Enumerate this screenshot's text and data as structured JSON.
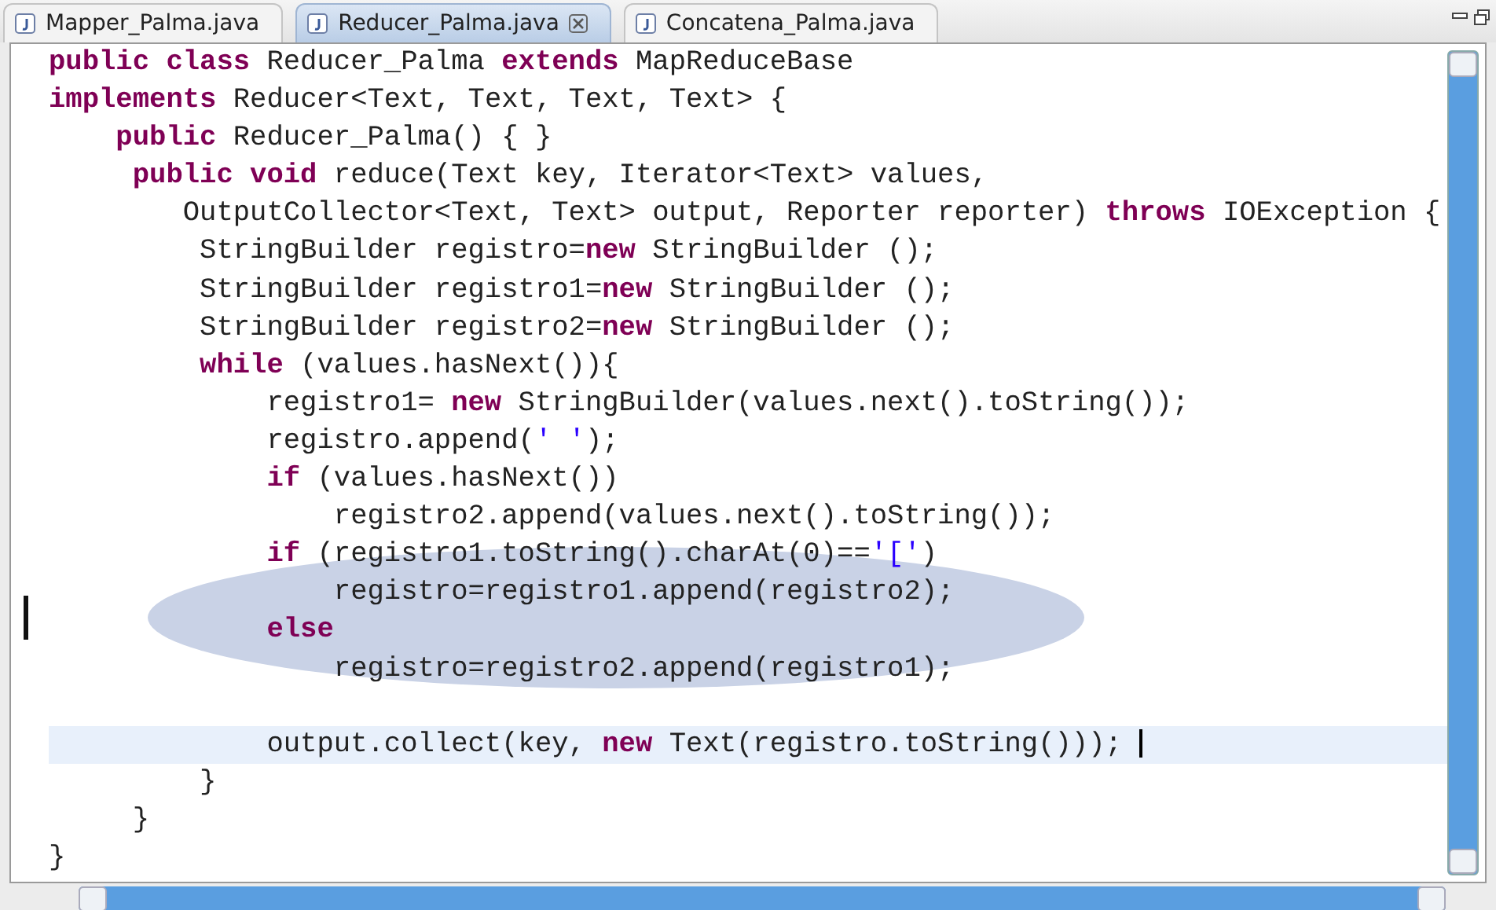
{
  "tabs": [
    {
      "label": "Mapper_Palma.java",
      "selected": false
    },
    {
      "label": "Reducer_Palma.java",
      "selected": true
    },
    {
      "label": "Concatena_Palma.java",
      "selected": false
    }
  ],
  "editor": {
    "lines": [
      {
        "kind": "code",
        "tokens": [
          {
            "kind": "keyword",
            "text": "public class"
          },
          {
            "kind": "plain",
            "text": " Reducer_Palma "
          },
          {
            "kind": "keyword",
            "text": "extends"
          },
          {
            "kind": "plain",
            "text": " MapReduceBase"
          }
        ]
      },
      {
        "kind": "code",
        "tokens": [
          {
            "kind": "keyword",
            "text": "implements"
          },
          {
            "kind": "plain",
            "text": " Reducer<Text, Text, Text, Text> {"
          }
        ]
      },
      {
        "kind": "code",
        "tokens": [
          {
            "kind": "keyword",
            "text": "    public"
          },
          {
            "kind": "plain",
            "text": " Reducer_Palma() { }"
          }
        ]
      },
      {
        "kind": "code",
        "tokens": [
          {
            "kind": "keyword",
            "text": "     public void"
          },
          {
            "kind": "plain",
            "text": " reduce(Text key, Iterator<Text> values,"
          }
        ]
      },
      {
        "kind": "code",
        "tokens": [
          {
            "kind": "plain",
            "text": "        OutputCollector<Text, Text> output, Reporter reporter) "
          },
          {
            "kind": "keyword",
            "text": "throws"
          },
          {
            "kind": "plain",
            "text": " IOException {"
          }
        ]
      },
      {
        "kind": "code",
        "tokens": [
          {
            "kind": "plain",
            "text": "         StringBuilder registro="
          },
          {
            "kind": "keyword",
            "text": "new"
          },
          {
            "kind": "plain",
            "text": " StringBuilder ();"
          }
        ]
      },
      {
        "kind": "code",
        "tokens": [
          {
            "kind": "plain",
            "text": "         StringBuilder registro1="
          },
          {
            "kind": "keyword",
            "text": "new"
          },
          {
            "kind": "plain",
            "text": " StringBuilder ();"
          }
        ]
      },
      {
        "kind": "code",
        "tokens": [
          {
            "kind": "plain",
            "text": "         StringBuilder registro2="
          },
          {
            "kind": "keyword",
            "text": "new"
          },
          {
            "kind": "plain",
            "text": " StringBuilder ();"
          }
        ]
      },
      {
        "kind": "code",
        "tokens": [
          {
            "kind": "keyword",
            "text": "         while"
          },
          {
            "kind": "plain",
            "text": " (values.hasNext()){"
          }
        ]
      },
      {
        "kind": "code",
        "tokens": [
          {
            "kind": "plain",
            "text": "             registro1= "
          },
          {
            "kind": "keyword",
            "text": "new"
          },
          {
            "kind": "plain",
            "text": " StringBuilder(values.next().toString());"
          }
        ]
      },
      {
        "kind": "code",
        "tokens": [
          {
            "kind": "plain",
            "text": "             registro.append("
          },
          {
            "kind": "string",
            "text": "' '"
          },
          {
            "kind": "plain",
            "text": ");"
          }
        ]
      },
      {
        "kind": "code",
        "tokens": [
          {
            "kind": "keyword",
            "text": "             if"
          },
          {
            "kind": "plain",
            "text": " (values.hasNext())"
          }
        ]
      },
      {
        "kind": "code",
        "tokens": [
          {
            "kind": "plain",
            "text": "                 registro2.append(values.next().toString());"
          }
        ]
      },
      {
        "kind": "code",
        "tokens": [
          {
            "kind": "keyword",
            "text": "             if"
          },
          {
            "kind": "plain",
            "text": " (registro1.toString().charAt(0)=="
          },
          {
            "kind": "string",
            "text": "'['"
          },
          {
            "kind": "plain",
            "text": ")"
          }
        ]
      },
      {
        "kind": "code",
        "tokens": [
          {
            "kind": "plain",
            "text": "                 registro=registro1.append(registro2);"
          }
        ],
        "marker": true
      },
      {
        "kind": "code",
        "tokens": [
          {
            "kind": "keyword",
            "text": "             else"
          }
        ]
      },
      {
        "kind": "code",
        "tokens": [
          {
            "kind": "plain",
            "text": "                 registro=registro2.append(registro1);"
          }
        ]
      },
      {
        "kind": "blank"
      },
      {
        "kind": "code",
        "tokens": [
          {
            "kind": "plain",
            "text": "             output.collect(key, "
          },
          {
            "kind": "keyword",
            "text": "new"
          },
          {
            "kind": "plain",
            "text": " Text(registro.toString())); "
          }
        ],
        "current": true
      },
      {
        "kind": "code",
        "tokens": [
          {
            "kind": "plain",
            "text": "         }"
          }
        ]
      },
      {
        "kind": "code",
        "tokens": [
          {
            "kind": "plain",
            "text": "     }"
          }
        ]
      },
      {
        "kind": "code",
        "tokens": [
          {
            "kind": "plain",
            "text": "}"
          }
        ]
      }
    ]
  }
}
